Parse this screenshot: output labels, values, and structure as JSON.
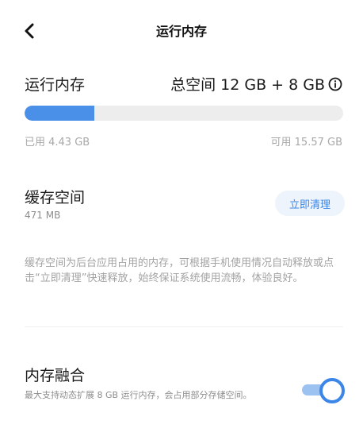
{
  "header": {
    "title": "运行内存"
  },
  "memory": {
    "label": "运行内存",
    "total": "总空间 12 GB + 8 GB",
    "used": "已用 4.43 GB",
    "available": "可用 15.57 GB",
    "used_fraction": 0.22,
    "bar_color": "#4a8fe8"
  },
  "cache": {
    "title": "缓存空间",
    "size": "471 MB",
    "clean_button": "立即清理",
    "description": "缓存空间为后台应用占用的内存，可根据手机使用情况自动释放或点击“立即清理”快速释放，始终保证系统使用流畅，体验良好。"
  },
  "fusion": {
    "title": "内存融合",
    "description": "最大支持动态扩展 8 GB 运行内存，会占用部分存储空间。",
    "enabled": true,
    "accent_color": "#3b86e6"
  },
  "icons": {
    "back": "chevron-left-icon",
    "info": "info-circle-icon"
  }
}
